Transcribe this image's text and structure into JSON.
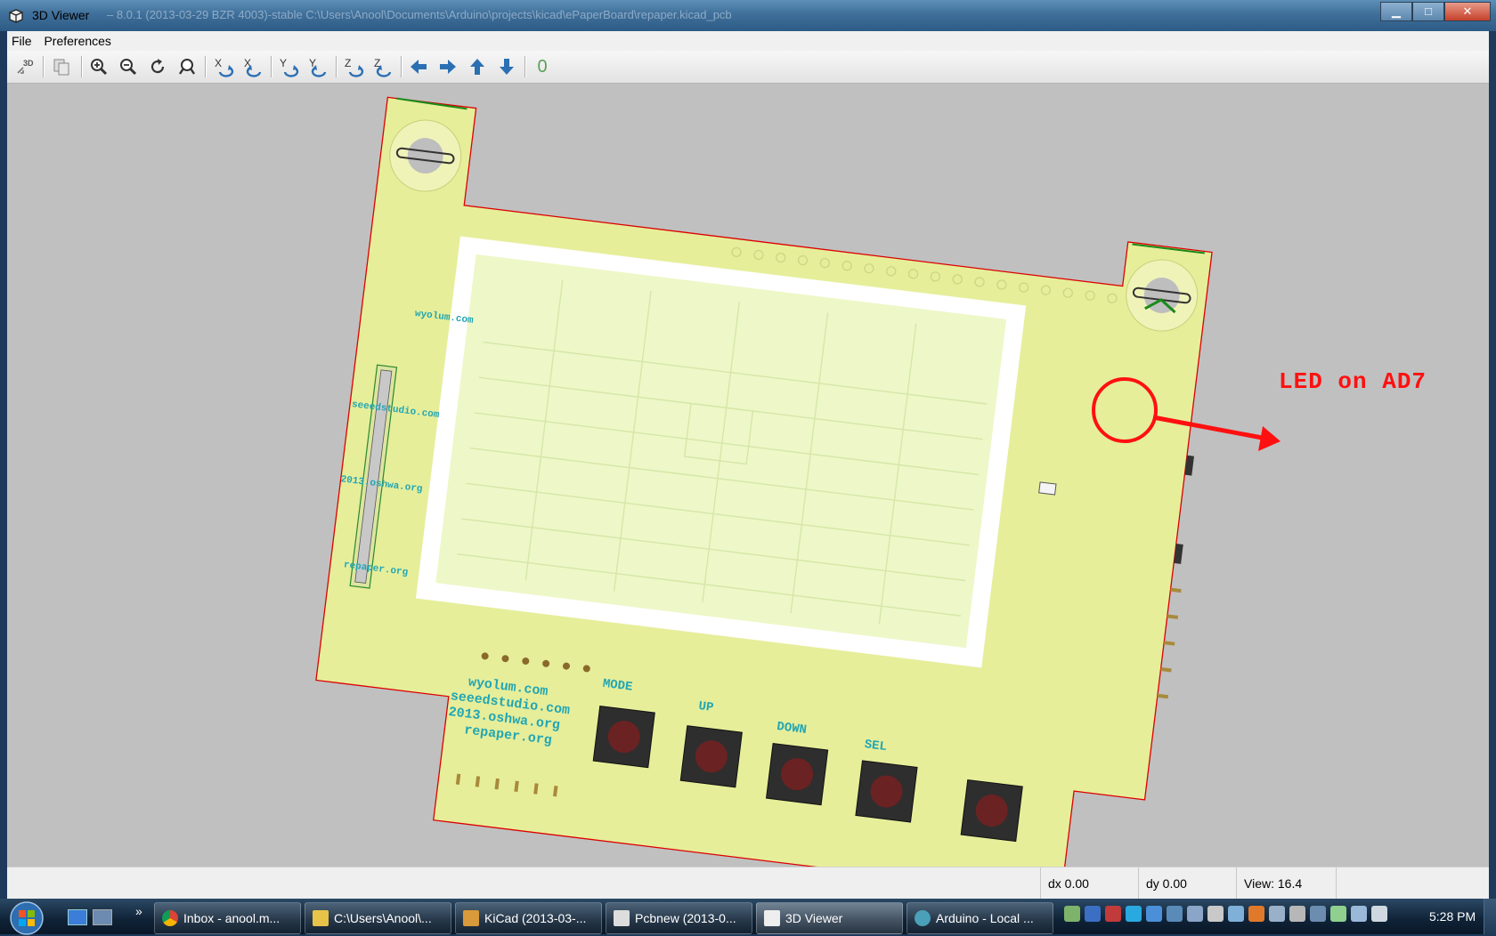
{
  "window": {
    "title": "3D Viewer",
    "title_path": "– 8.0.1 (2013-03-29 BZR 4003)-stable  C:\\Users\\Anool\\Documents\\Arduino\\projects\\kicad\\ePaperBoard\\repaper.kicad_pcb",
    "minimize": "▁",
    "maximize": "□",
    "close": "✕"
  },
  "menu": [
    "File",
    "Preferences"
  ],
  "toolbar": {
    "icons": [
      "3d-reload-icon",
      "copy-icon",
      "zoom-in-icon",
      "zoom-out-icon",
      "redraw-icon",
      "zoom-fit-icon",
      "rotate-x-pos-icon",
      "rotate-x-neg-icon",
      "rotate-y-pos-icon",
      "rotate-y-neg-icon",
      "rotate-z-pos-icon",
      "rotate-z-neg-icon",
      "move-left-icon",
      "move-right-icon",
      "move-up-icon",
      "move-down-icon",
      "ortho-icon"
    ],
    "rotation_labels": [
      "X",
      "X",
      "Y",
      "Y",
      "Z",
      "Z"
    ],
    "ortho_label": "0"
  },
  "board": {
    "silk_left": [
      "wyolum.com",
      "seeedstudio.com",
      "2013.oshwa.org",
      "repaper.org"
    ],
    "silk_bottom": [
      "wyolum.com",
      "seeedstudio.com",
      "2013.oshwa.org",
      "repaper.org"
    ],
    "buttons": [
      "MODE",
      "UP",
      "DOWN",
      "SEL"
    ]
  },
  "annotation": {
    "text": "LED on AD7",
    "color": "#ff1010"
  },
  "status": {
    "dx": "dx 0.00",
    "dy": "dy 0.00",
    "view": "View: 16.4"
  },
  "taskbar": {
    "buttons": [
      {
        "label": "Inbox - anool.m...",
        "icon": "chrome-icon"
      },
      {
        "label": "C:\\Users\\Anool\\...",
        "icon": "folder-icon"
      },
      {
        "label": "KiCad (2013-03-...",
        "icon": "kicad-icon"
      },
      {
        "label": "Pcbnew (2013-0...",
        "icon": "pcbnew-icon"
      },
      {
        "label": "3D Viewer",
        "icon": "3d-viewer-icon"
      },
      {
        "label": "Arduino - Local ...",
        "icon": "arduino-icon"
      }
    ],
    "overflow": "»",
    "clock": "5:28 PM"
  }
}
